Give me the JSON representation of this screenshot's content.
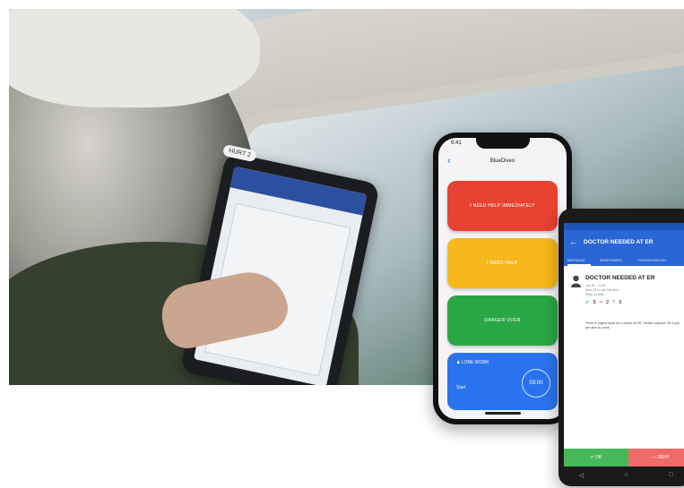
{
  "tablet": {
    "badge": "HURT 2"
  },
  "iphone": {
    "status_time": "9:41",
    "app_title": "BlueDiveo",
    "buttons": [
      {
        "label": "I NEED HELP IMMEDIATELY",
        "color": "#e84233"
      },
      {
        "label": "I NEED HELP",
        "color": "#f6b81a"
      },
      {
        "label": "DANGER OVER",
        "color": "#29a744"
      }
    ],
    "lone_work": {
      "title": "LONE WORK",
      "subtitle": "Start",
      "timer": "03:00"
    }
  },
  "android": {
    "title": "DOCTOR NEEDED AT ER",
    "tabs": [
      "MESSAGE",
      "RESPONSES",
      "CONVERSATION"
    ],
    "message_title": "DOCTOR NEEDED AT ER",
    "meta": [
      "Jan 25 - 10:45",
      "Alert 26 to rate this alert",
      "Read all tabs"
    ],
    "counts": {
      "ok": "5",
      "deny": "2",
      "unknown": "3"
    },
    "body": "There is urgent need for a doctor at ER. Please respond OK if you are able to come.",
    "ok_label": "OK",
    "deny_label": "DENY"
  }
}
